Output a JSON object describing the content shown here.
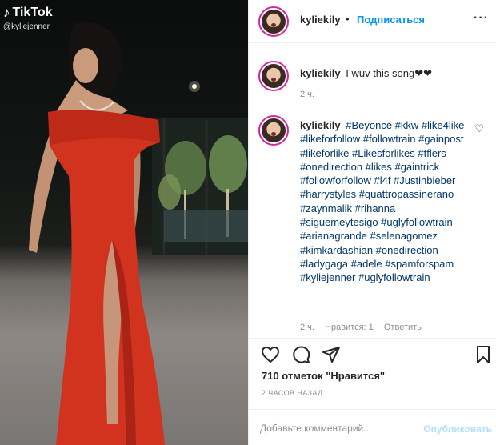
{
  "media": {
    "watermark_brand": "TikTok",
    "watermark_handle": "@kyliejenner"
  },
  "post": {
    "username": "kyliekily",
    "dot": "•",
    "follow_label": "Подписаться",
    "more_icon": "more-dots-icon"
  },
  "comments": [
    {
      "username": "kyliekily",
      "text": "I wuv this song❤❤",
      "time": "2 ч."
    },
    {
      "username": "kyliekily",
      "text": "#Beyoncé #kkw #like4like #likeforfollow #followtrain #gainpost #likeforlike #Likesforlikes #tflers #onedirection #likes #gaintrick #followforfollow #l4f #Justinbieber #harrystyles #quattropassinerano #zaynmalik #rihanna #siguemeytesigo #uglyfollowtrain #arianagrande #selenagomez #kimkardashian #onedirection #ladygaga #adele #spamforspam #kyliejenner #uglyfollowtrain",
      "time": "2 ч.",
      "likes": "Нравится: 1",
      "reply": "Ответить"
    }
  ],
  "likes_text": "710 отметок \"Нравится\"",
  "time_ago": "2 ЧАСОВ НАЗАД",
  "add_comment": {
    "placeholder": "Добавьте комментарий...",
    "publish_label": "Опубликовать"
  },
  "colors": {
    "accent": "#0095f6",
    "link": "#00376b",
    "muted": "#8e8e8e",
    "publish_disabled": "#b2dffc",
    "dress": "#d2331f"
  }
}
